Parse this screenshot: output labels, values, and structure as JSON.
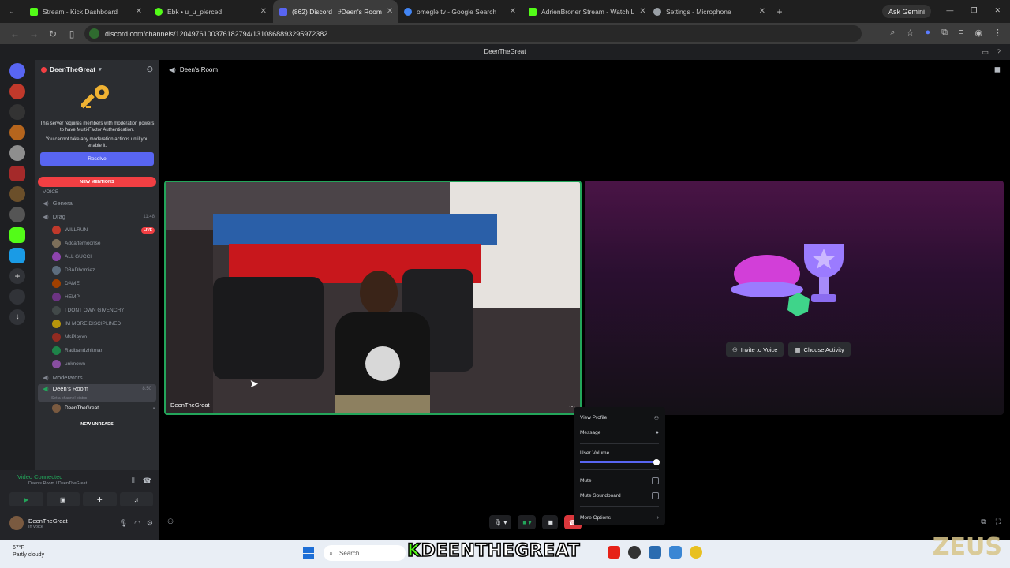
{
  "browser": {
    "tabs": [
      {
        "label": "Stream - Kick Dashboard",
        "color": "#53fc18"
      },
      {
        "label": "Ebk • u_u_pierced",
        "color": "#53fc18"
      },
      {
        "label": "(862) Discord | #Deen's Room",
        "color": "#5865f2"
      },
      {
        "label": "omegle tv - Google Search",
        "color": "#4285f4"
      },
      {
        "label": "AdrienBroner Stream - Watch L",
        "color": "#53fc18"
      },
      {
        "label": "Settings - Microphone",
        "color": "#9aa0a6"
      }
    ],
    "url": "discord.com/channels/1204976100376182794/1310868893295972382",
    "gemini": "Ask Gemini"
  },
  "discord": {
    "title": "DeenTheGreat",
    "server_name": "DeenTheGreat",
    "mfa_text": "This server requires members with moderation powers to have Multi-Factor Authentication.",
    "mfa_text2": "You cannot take any moderation actions until you enable it.",
    "resolve_label": "Resolve",
    "new_mentions": "NEW MENTIONS",
    "voice_category": "VOICE",
    "channels": {
      "general": "General",
      "drag": "Drag",
      "drag_time": "11:48",
      "moderators": "Moderators",
      "deens_room": "Deen's Room",
      "deens_room_time": "8:50",
      "deens_room_status": "Set a channel status"
    },
    "drag_members": [
      {
        "name": "WILLRUN",
        "badge": "LIVE"
      },
      {
        "name": "Adcafternoonse"
      },
      {
        "name": "ALL GUCCI"
      },
      {
        "name": "D3ADhomiez"
      },
      {
        "name": "DAME"
      },
      {
        "name": "HEMP"
      },
      {
        "name": "I DONT OWN GIVENCHY"
      },
      {
        "name": "IM MORE DISCIPLINED"
      },
      {
        "name": "MsPlayxo"
      },
      {
        "name": "Radbandzhitman"
      },
      {
        "name": "unknown"
      }
    ],
    "room_member": "DeenTheGreat",
    "new_unreads": "NEW UNREADS",
    "voice_status": "Video Connected",
    "voice_sub": "Deen's Room / DeenTheGreat",
    "user_name": "DeenTheGreat",
    "user_status": "In voice",
    "voice_header": "Deen's Room",
    "tile_name": "DeenTheGreat",
    "invite_label": "Invite to Voice",
    "activity_label": "Choose Activity",
    "menu": {
      "view_profile": "View Profile",
      "message": "Message",
      "user_volume": "User Volume",
      "mute": "Mute",
      "mute_soundboard": "Mute Soundboard",
      "more_options": "More Options",
      "volume_fraction": 0.97
    }
  },
  "taskbar": {
    "temp": "67°F",
    "weather": "Partly cloudy",
    "search_placeholder": "Search"
  },
  "overlay": {
    "banner": "DEENTHEGREAT",
    "watermark": "ZEUS"
  }
}
